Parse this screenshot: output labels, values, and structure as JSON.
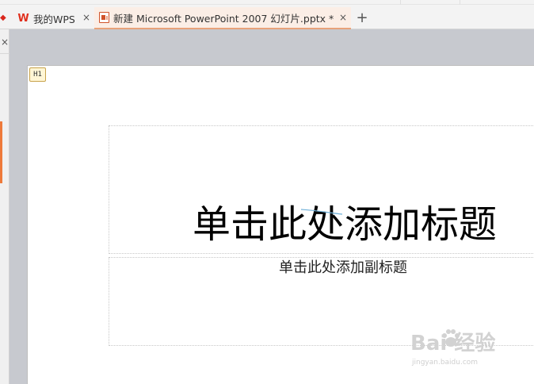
{
  "tabs": [
    {
      "label": "我的WPS",
      "icon": "wps-logo-icon",
      "active": false
    },
    {
      "label": "新建 Microsoft PowerPoint 2007 幻灯片.pptx *",
      "icon": "ppt-file-icon",
      "active": true
    }
  ],
  "add_tab_glyph": "+",
  "close_glyph": "×",
  "slide": {
    "level_tag": "H1",
    "title_placeholder": "单击此处添加标题",
    "subtitle_placeholder": "单击此处添加副标题"
  },
  "watermark": {
    "main": "Bai  经验",
    "sub": "jingyan.baidu.com"
  },
  "colors": {
    "active_tab_bg": "#fbeee6",
    "active_tab_underline": "#e8a27a",
    "accent_bar": "#ee7a3a",
    "wps_red": "#e0301e",
    "workspace_bg": "#c7c9cf"
  }
}
